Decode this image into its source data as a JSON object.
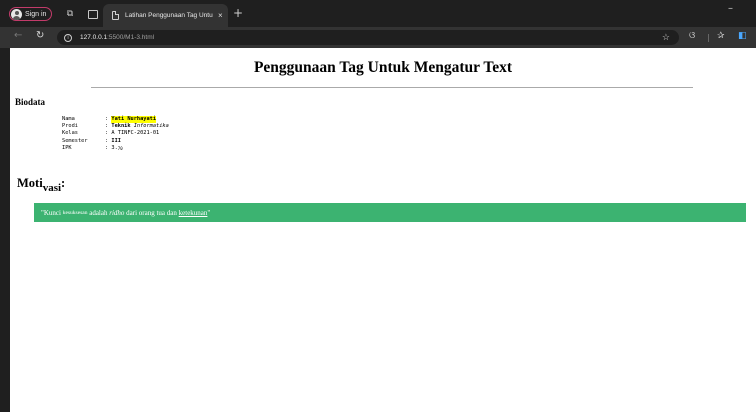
{
  "browser": {
    "signin_label": "Sign in",
    "tab_title": "Latihan Penggunaan Tag Untuk M",
    "tab_close": "×",
    "new_tab": "+",
    "minimize": "–",
    "address_host": "127.0.0.1",
    "address_rest": ":5500/M1-3.html"
  },
  "page": {
    "title": "Penggunaan Tag Untuk Mengatur Text",
    "biodata_heading": "Biodata",
    "biodata": {
      "nama": {
        "label": "Nama",
        "sep": ": ",
        "value": "Yati Nurhayati"
      },
      "prodi": {
        "label": "Prodi",
        "sep": ": ",
        "value_bold": "Teknik",
        "value_italic": " Informatika"
      },
      "kelas": {
        "label": "Kelas",
        "sep": ": ",
        "value": "A TINFC-2021-01"
      },
      "semester": {
        "label": "Semester",
        "sep": ": ",
        "value": "III"
      },
      "ipk": {
        "label": "IPK",
        "sep": ": ",
        "value": "3.",
        "sup": "70"
      }
    },
    "motivasi": {
      "main": "Moti",
      "sub": "vasi",
      "colon": ":"
    },
    "quote": {
      "open": "\"Kunci ",
      "small": "kesuksesan",
      "mid": " adalah ",
      "italic": "ridho",
      "mid2": " dari orang tua dan ",
      "underline": "ketekunan",
      "close": "\""
    }
  },
  "colors": {
    "highlight": "#ffff00",
    "quote_bg": "#3cb371",
    "signin_border": "#c23b6a"
  },
  "icons": [
    "avatar-icon",
    "collections-icon",
    "tabs-icon",
    "document-icon",
    "back-icon",
    "reload-icon",
    "info-icon",
    "star-icon",
    "copilot-icon",
    "favorites-icon",
    "edge-sidebar-icon"
  ]
}
